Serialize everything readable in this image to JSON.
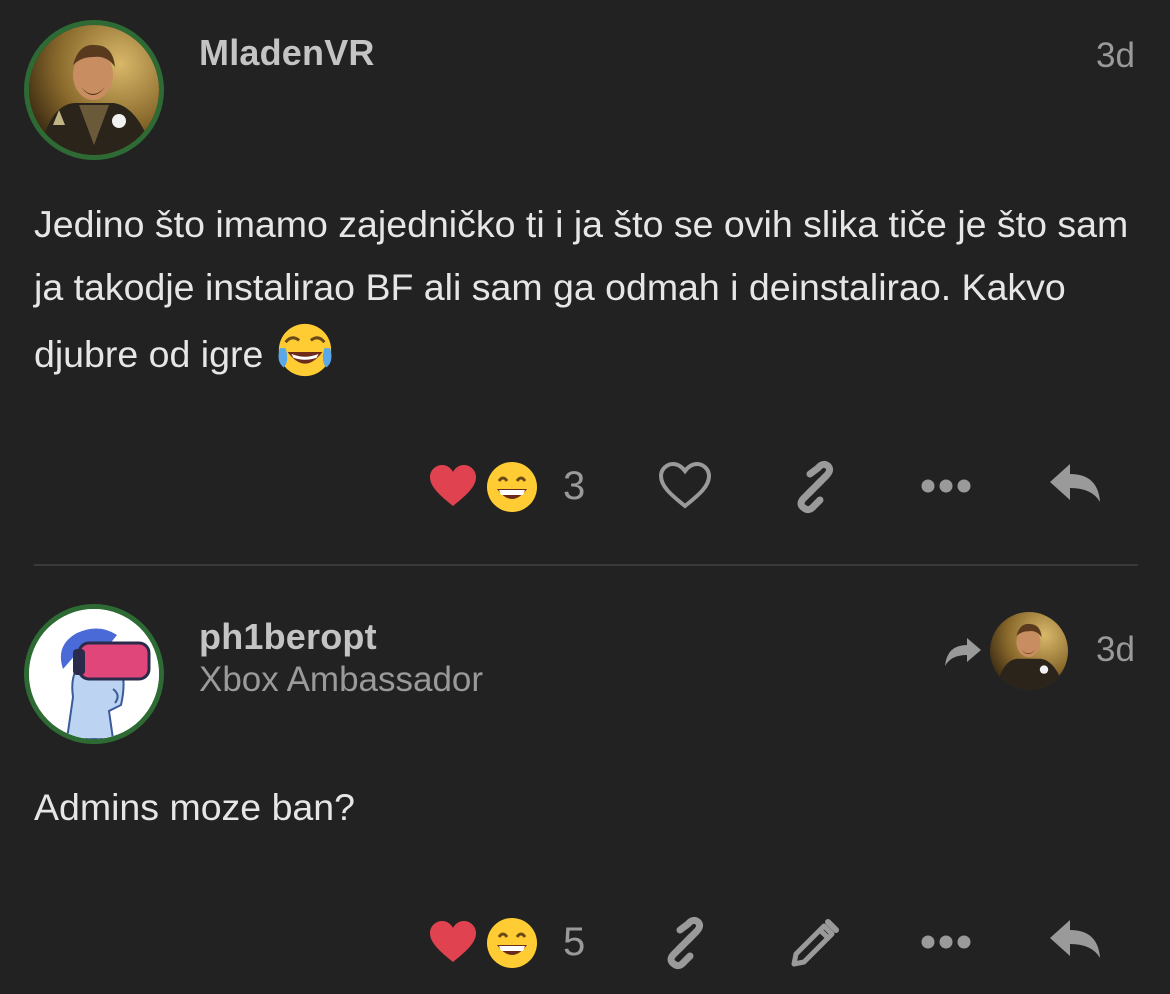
{
  "posts": [
    {
      "username": "MladenVR",
      "user_title": "",
      "date": "3d",
      "body": "Jedino što imamo zajedničko ti i ja što se ovih slika tiče je što sam ja takodje instalirao BF ali sam ga odmah i deinstalirao. Kakvo djubre od igre",
      "body_emoji": "joy-emoji",
      "reaction_count": "3",
      "reactions": [
        "heart-reaction",
        "grin-reaction"
      ],
      "actions": [
        "like-icon",
        "link-icon",
        "more-icon",
        "reply-icon"
      ]
    },
    {
      "username": "ph1beropt",
      "user_title": "Xbox Ambassador",
      "date": "3d",
      "reply_to_indicator": "reply-arrow-icon",
      "body": "Admins moze ban?",
      "reaction_count": "5",
      "reactions": [
        "heart-reaction",
        "grin-reaction"
      ],
      "actions": [
        "link-icon",
        "edit-icon",
        "more-icon",
        "reply-icon"
      ]
    }
  ],
  "colors": {
    "background": "#222222",
    "avatar_ring": "#2e6b34",
    "heart": "#e0434f",
    "icon_gray": "#9a9a9a",
    "divider": "#3a3a3a"
  }
}
